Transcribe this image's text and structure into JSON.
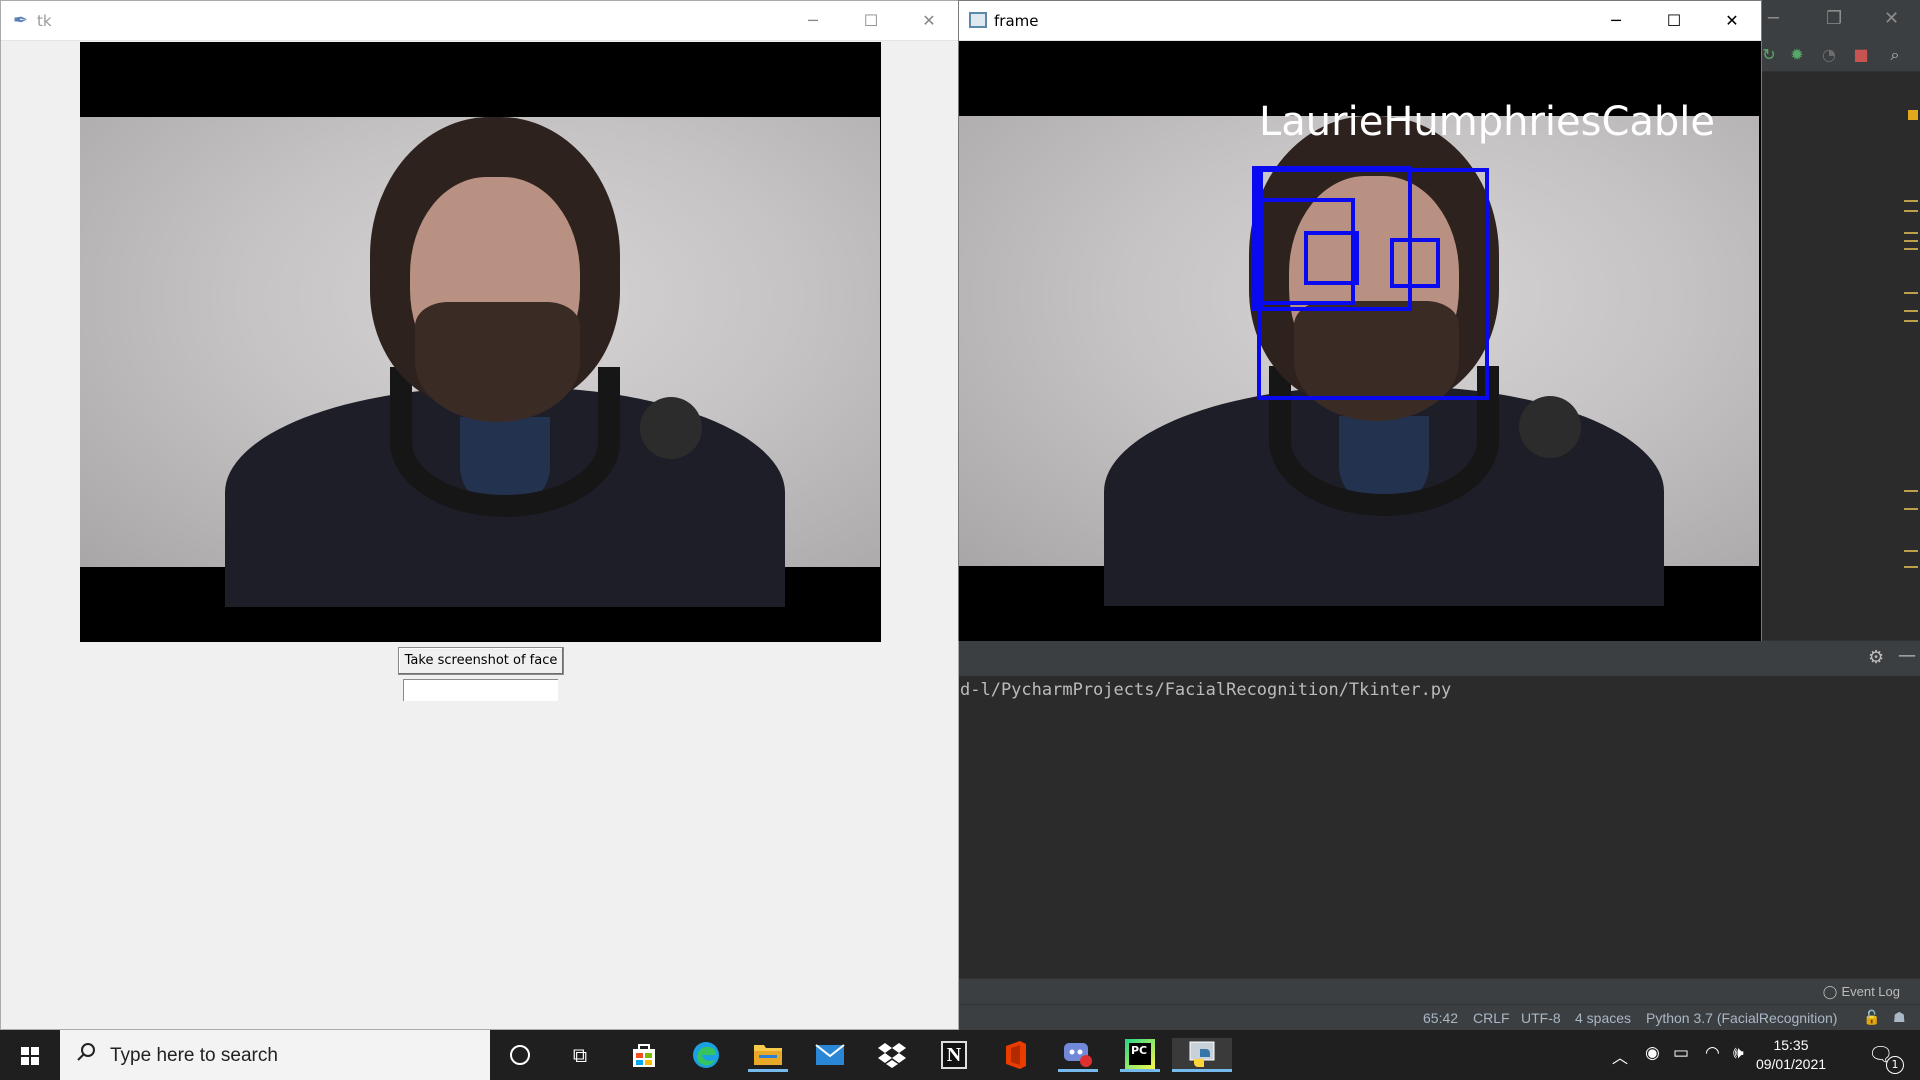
{
  "tk_window": {
    "title": "tk",
    "button_label": "Take screenshot of face",
    "entry_value": ""
  },
  "frame_window": {
    "title": "frame",
    "detected_name": "LaurieHumphriesCable"
  },
  "ide": {
    "console_path": "d-l/PycharmProjects/FacialRecognition/Tkinter.py",
    "event_log": "Event Log",
    "status": {
      "position": "65:42",
      "line_sep": "CRLF",
      "encoding": "UTF-8",
      "indent": "4 spaces",
      "interpreter": "Python 3.7 (FacialRecognition)"
    }
  },
  "taskbar": {
    "search_placeholder": "Type here to search",
    "time": "15:35",
    "date": "09/01/2021",
    "notification_count": "1"
  },
  "icons": [
    "windows-start-icon",
    "search-icon",
    "cortana-icon",
    "task-view-icon",
    "store-icon",
    "edge-icon",
    "file-explorer-icon",
    "mail-icon",
    "dropbox-icon",
    "notion-icon",
    "office-icon",
    "discord-record-icon",
    "pycharm-icon",
    "python-icon"
  ],
  "colors": {
    "detection_box": "#0a0af0",
    "ide_background": "#2b2b2b",
    "tk_background": "#f0f0f0",
    "taskbar": "#1f1f1f"
  }
}
